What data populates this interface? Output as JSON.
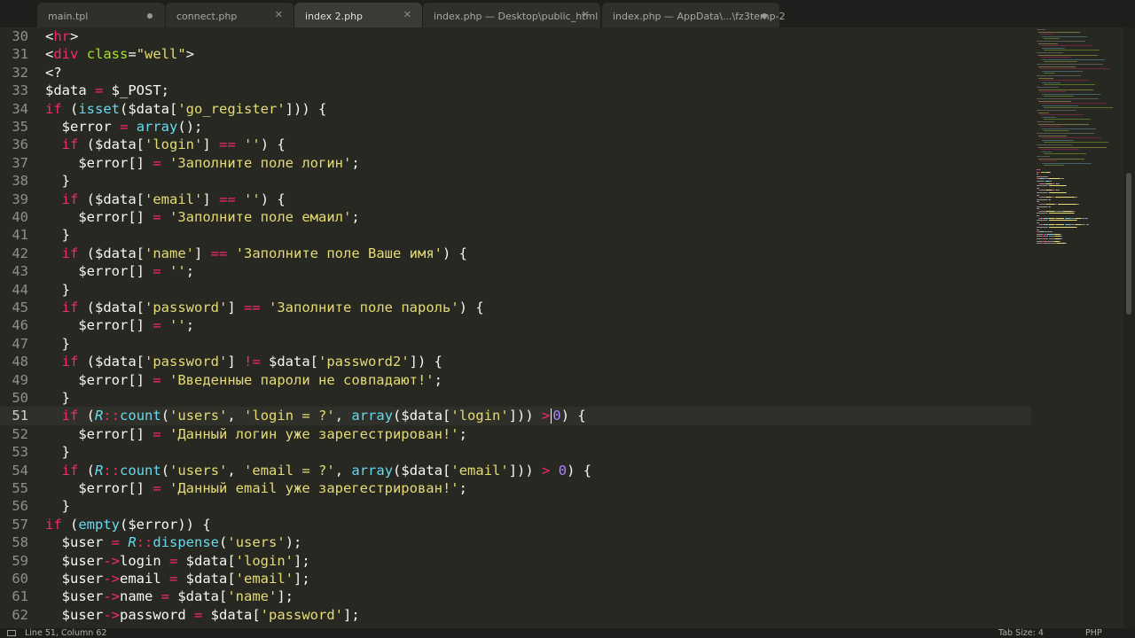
{
  "tabs": [
    {
      "label": "main.tpl",
      "state": "modified"
    },
    {
      "label": "connect.php",
      "state": "close"
    },
    {
      "label": "index 2.php",
      "state": "close",
      "active": true
    },
    {
      "label": "index.php — Desktop\\public_html",
      "state": "close"
    },
    {
      "label": "index.php — AppData\\...\\fz3temp-2",
      "state": "modified"
    }
  ],
  "current_line": 51,
  "lines": [
    {
      "n": "30",
      "tokens": [
        [
          "p",
          "<"
        ],
        [
          "t",
          "hr"
        ],
        [
          "p",
          ">"
        ]
      ]
    },
    {
      "n": "31",
      "tokens": [
        [
          "p",
          "<"
        ],
        [
          "t",
          "div"
        ],
        [
          "p",
          " "
        ],
        [
          "a",
          "class"
        ],
        [
          "p",
          "="
        ],
        [
          "s",
          "\"well\""
        ],
        [
          "p",
          ">"
        ]
      ]
    },
    {
      "n": "32",
      "tokens": [
        [
          "p",
          "<?"
        ]
      ]
    },
    {
      "n": "33",
      "tokens": [
        [
          "p",
          "$data "
        ],
        [
          "t",
          "="
        ],
        [
          "p",
          " $_POST;"
        ]
      ]
    },
    {
      "n": "34",
      "tokens": [
        [
          "t",
          "if"
        ],
        [
          "p",
          " ("
        ],
        [
          "f",
          "isset"
        ],
        [
          "p",
          "($data["
        ],
        [
          "s",
          "'go_register'"
        ],
        [
          "p",
          "])) {"
        ]
      ]
    },
    {
      "n": "35",
      "tokens": [
        [
          "p",
          "  $error "
        ],
        [
          "t",
          "="
        ],
        [
          "p",
          " "
        ],
        [
          "f",
          "array"
        ],
        [
          "p",
          "();"
        ]
      ]
    },
    {
      "n": "36",
      "tokens": [
        [
          "p",
          "  "
        ],
        [
          "t",
          "if"
        ],
        [
          "p",
          " ($data["
        ],
        [
          "s",
          "'login'"
        ],
        [
          "p",
          "] "
        ],
        [
          "t",
          "=="
        ],
        [
          "p",
          " "
        ],
        [
          "s",
          "''"
        ],
        [
          "p",
          ") {"
        ]
      ]
    },
    {
      "n": "37",
      "tokens": [
        [
          "p",
          "    $error[] "
        ],
        [
          "t",
          "="
        ],
        [
          "p",
          " "
        ],
        [
          "s",
          "'Заполните поле логин'"
        ],
        [
          "p",
          ";"
        ]
      ]
    },
    {
      "n": "38",
      "tokens": [
        [
          "p",
          "  }"
        ]
      ]
    },
    {
      "n": "39",
      "tokens": [
        [
          "p",
          "  "
        ],
        [
          "t",
          "if"
        ],
        [
          "p",
          " ($data["
        ],
        [
          "s",
          "'email'"
        ],
        [
          "p",
          "] "
        ],
        [
          "t",
          "=="
        ],
        [
          "p",
          " "
        ],
        [
          "s",
          "''"
        ],
        [
          "p",
          ") {"
        ]
      ]
    },
    {
      "n": "40",
      "tokens": [
        [
          "p",
          "    $error[] "
        ],
        [
          "t",
          "="
        ],
        [
          "p",
          " "
        ],
        [
          "s",
          "'Заполните поле емаил'"
        ],
        [
          "p",
          ";"
        ]
      ]
    },
    {
      "n": "41",
      "tokens": [
        [
          "p",
          "  }"
        ]
      ]
    },
    {
      "n": "42",
      "tokens": [
        [
          "p",
          "  "
        ],
        [
          "t",
          "if"
        ],
        [
          "p",
          " ($data["
        ],
        [
          "s",
          "'name'"
        ],
        [
          "p",
          "] "
        ],
        [
          "t",
          "=="
        ],
        [
          "p",
          " "
        ],
        [
          "s",
          "'Заполните поле Ваше имя'"
        ],
        [
          "p",
          ") {"
        ]
      ]
    },
    {
      "n": "43",
      "tokens": [
        [
          "p",
          "    $error[] "
        ],
        [
          "t",
          "="
        ],
        [
          "p",
          " "
        ],
        [
          "s",
          "''"
        ],
        [
          "p",
          ";"
        ]
      ]
    },
    {
      "n": "44",
      "tokens": [
        [
          "p",
          "  }"
        ]
      ]
    },
    {
      "n": "45",
      "tokens": [
        [
          "p",
          "  "
        ],
        [
          "t",
          "if"
        ],
        [
          "p",
          " ($data["
        ],
        [
          "s",
          "'password'"
        ],
        [
          "p",
          "] "
        ],
        [
          "t",
          "=="
        ],
        [
          "p",
          " "
        ],
        [
          "s",
          "'Заполните поле пароль'"
        ],
        [
          "p",
          ") {"
        ]
      ]
    },
    {
      "n": "46",
      "tokens": [
        [
          "p",
          "    $error[] "
        ],
        [
          "t",
          "="
        ],
        [
          "p",
          " "
        ],
        [
          "s",
          "''"
        ],
        [
          "p",
          ";"
        ]
      ]
    },
    {
      "n": "47",
      "tokens": [
        [
          "p",
          "  }"
        ]
      ]
    },
    {
      "n": "48",
      "tokens": [
        [
          "p",
          "  "
        ],
        [
          "t",
          "if"
        ],
        [
          "p",
          " ($data["
        ],
        [
          "s",
          "'password'"
        ],
        [
          "p",
          "] "
        ],
        [
          "t",
          "!="
        ],
        [
          "p",
          " $data["
        ],
        [
          "s",
          "'password2'"
        ],
        [
          "p",
          "]) {"
        ]
      ]
    },
    {
      "n": "49",
      "tokens": [
        [
          "p",
          "    $error[] "
        ],
        [
          "t",
          "="
        ],
        [
          "p",
          " "
        ],
        [
          "s",
          "'Введенные пароли не совпадают!'"
        ],
        [
          "p",
          ";"
        ]
      ]
    },
    {
      "n": "50",
      "tokens": [
        [
          "p",
          "  }"
        ]
      ]
    },
    {
      "n": "51",
      "tokens": [
        [
          "p",
          "  "
        ],
        [
          "t",
          "if"
        ],
        [
          "p",
          " ("
        ],
        [
          "c",
          "R"
        ],
        [
          "t",
          "::"
        ],
        [
          "f",
          "count"
        ],
        [
          "p",
          "("
        ],
        [
          "s",
          "'users'"
        ],
        [
          "p",
          ", "
        ],
        [
          "s",
          "'login = ?'"
        ],
        [
          "p",
          ", "
        ],
        [
          "f",
          "array"
        ],
        [
          "p",
          "($data["
        ],
        [
          "s",
          "'login'"
        ],
        [
          "p",
          "])) "
        ],
        [
          "t",
          ">"
        ],
        [
          "cursor",
          ""
        ],
        [
          "n",
          "0"
        ],
        [
          "p",
          ") {"
        ]
      ]
    },
    {
      "n": "52",
      "tokens": [
        [
          "p",
          "    $error[] "
        ],
        [
          "t",
          "="
        ],
        [
          "p",
          " "
        ],
        [
          "s",
          "'Данный логин уже зарегестрирован!'"
        ],
        [
          "p",
          ";"
        ]
      ]
    },
    {
      "n": "53",
      "tokens": [
        [
          "p",
          "  }"
        ]
      ]
    },
    {
      "n": "54",
      "tokens": [
        [
          "p",
          "  "
        ],
        [
          "t",
          "if"
        ],
        [
          "p",
          " ("
        ],
        [
          "c",
          "R"
        ],
        [
          "t",
          "::"
        ],
        [
          "f",
          "count"
        ],
        [
          "p",
          "("
        ],
        [
          "s",
          "'users'"
        ],
        [
          "p",
          ", "
        ],
        [
          "s",
          "'email = ?'"
        ],
        [
          "p",
          ", "
        ],
        [
          "f",
          "array"
        ],
        [
          "p",
          "($data["
        ],
        [
          "s",
          "'email'"
        ],
        [
          "p",
          "])) "
        ],
        [
          "t",
          ">"
        ],
        [
          "p",
          " "
        ],
        [
          "n",
          "0"
        ],
        [
          "p",
          ") {"
        ]
      ]
    },
    {
      "n": "55",
      "tokens": [
        [
          "p",
          "    $error[] "
        ],
        [
          "t",
          "="
        ],
        [
          "p",
          " "
        ],
        [
          "s",
          "'Данный email уже зарегестрирован!'"
        ],
        [
          "p",
          ";"
        ]
      ]
    },
    {
      "n": "56",
      "tokens": [
        [
          "p",
          "  }"
        ]
      ]
    },
    {
      "n": "57",
      "tokens": [
        [
          "t",
          "if"
        ],
        [
          "p",
          " ("
        ],
        [
          "f",
          "empty"
        ],
        [
          "p",
          "($error)) {"
        ]
      ]
    },
    {
      "n": "58",
      "tokens": [
        [
          "p",
          "  $user "
        ],
        [
          "t",
          "="
        ],
        [
          "p",
          " "
        ],
        [
          "c",
          "R"
        ],
        [
          "t",
          "::"
        ],
        [
          "f",
          "dispense"
        ],
        [
          "p",
          "("
        ],
        [
          "s",
          "'users'"
        ],
        [
          "p",
          ");"
        ]
      ]
    },
    {
      "n": "59",
      "tokens": [
        [
          "p",
          "  $user"
        ],
        [
          "t",
          "->"
        ],
        [
          "p",
          "login "
        ],
        [
          "t",
          "="
        ],
        [
          "p",
          " $data["
        ],
        [
          "s",
          "'login'"
        ],
        [
          "p",
          "];"
        ]
      ]
    },
    {
      "n": "60",
      "tokens": [
        [
          "p",
          "  $user"
        ],
        [
          "t",
          "->"
        ],
        [
          "p",
          "email "
        ],
        [
          "t",
          "="
        ],
        [
          "p",
          " $data["
        ],
        [
          "s",
          "'email'"
        ],
        [
          "p",
          "];"
        ]
      ]
    },
    {
      "n": "61",
      "tokens": [
        [
          "p",
          "  $user"
        ],
        [
          "t",
          "->"
        ],
        [
          "p",
          "name "
        ],
        [
          "t",
          "="
        ],
        [
          "p",
          " $data["
        ],
        [
          "s",
          "'name'"
        ],
        [
          "p",
          "];"
        ]
      ]
    },
    {
      "n": "62",
      "tokens": [
        [
          "p",
          "  $user"
        ],
        [
          "t",
          "->"
        ],
        [
          "p",
          "password "
        ],
        [
          "t",
          "="
        ],
        [
          "p",
          " $data["
        ],
        [
          "s",
          "'password'"
        ],
        [
          "p",
          "];"
        ]
      ]
    }
  ],
  "status": {
    "position": "Line 51, Column 62",
    "tab_size": "Tab Size: 4",
    "syntax": "PHP"
  },
  "colors": {
    "background": "#272822",
    "keyword": "#f92672",
    "string": "#e6db74",
    "function": "#66d9ef",
    "attribute": "#a6e22e",
    "number": "#ae81ff",
    "text": "#f8f8f2"
  }
}
